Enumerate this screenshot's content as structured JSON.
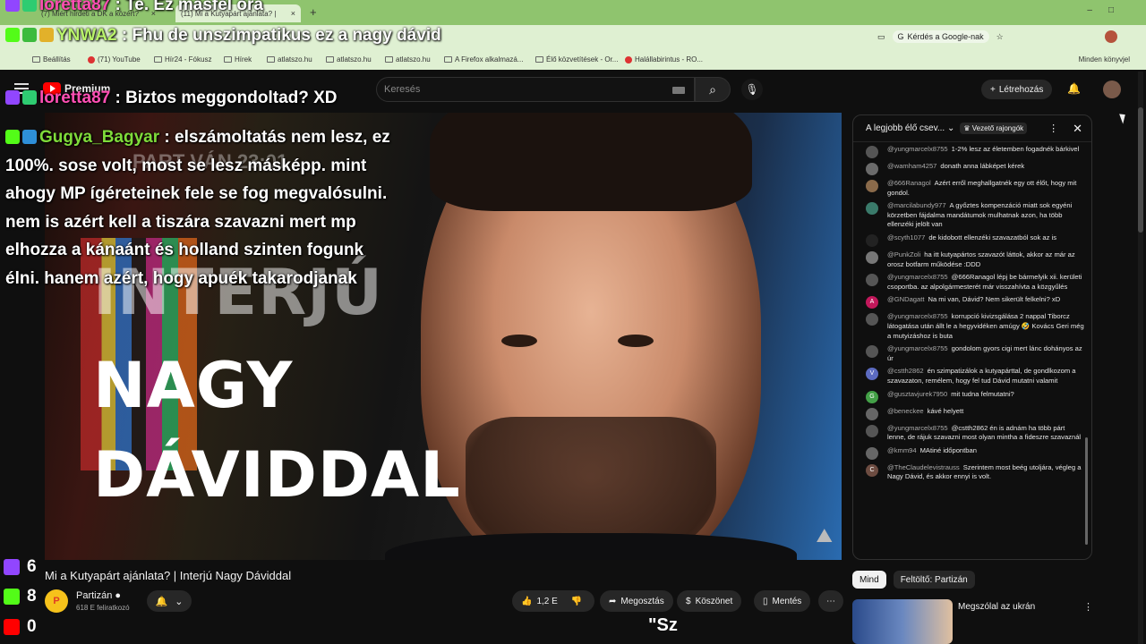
{
  "browser": {
    "tabs": [
      {
        "label": "(7) Miért hirdeti a DK a közért?"
      },
      {
        "label": "(11) Mi a Kutyapárt ajánlata? |"
      }
    ],
    "new_tab": "+",
    "google_search_label": "Kérdés a Google-nak",
    "bookmarks": [
      {
        "label": "Beállítás"
      },
      {
        "label": "(71) YouTube"
      },
      {
        "label": "Hír24 - Fókusz"
      },
      {
        "label": "Hírek"
      },
      {
        "label": "atlatszo.hu"
      },
      {
        "label": "atlatszo.hu"
      },
      {
        "label": "atlatszo.hu"
      },
      {
        "label": "A Firefox alkalmazá..."
      },
      {
        "label": "Élő közvetítések - Or..."
      },
      {
        "label": "Halállabirintus - RO..."
      }
    ],
    "bookmarks_right": "Minden könyvjel"
  },
  "youtube": {
    "logo_text": "Premium",
    "search_placeholder": "Keresés",
    "create_label": "Létrehozás"
  },
  "video": {
    "title_overlay_lines": [
      "INTERJÚ",
      "NAGY",
      "DÁVIDDAL"
    ],
    "part_text": "PART VÁN 23:01",
    "title": "Mi a Kutyapárt ajánlata? | Interjú Nagy Dáviddal",
    "channel_name": "Partizán",
    "channel_initial": "P",
    "subscribers": "618 E feliratkozó",
    "likes": "1,2 E",
    "share_label": "Megosztás",
    "thanks_label": "Köszönet",
    "save_label": "Mentés",
    "caption": "\"Sz"
  },
  "live_chat": {
    "header_title": "A legjobb élő csev...",
    "leader_label": "Vezető rajongók",
    "messages": [
      {
        "author": "@yungmarcelx8755",
        "text": "1-2% lesz az életemben fogadnék bárkivel",
        "avatar": ""
      },
      {
        "author": "@wamham4257",
        "text": "donath anna lábképet kérek",
        "avatar": ""
      },
      {
        "author": "@666Ranagol",
        "text": "Azért erről meghallgatnék egy ott élőt, hogy mit gondol.",
        "avatar": ""
      },
      {
        "author": "@marcilabundy977",
        "text": "A győztes kompenzáció miatt sok egyéni körzetben fájdalma mandátumok mulhatnak azon, ha több ellenzéki jelölt van",
        "avatar": ""
      },
      {
        "author": "@scyth1077",
        "text": "de kidobott ellenzéki szavazatból sok az is",
        "avatar": ""
      },
      {
        "author": "@PunkZoli",
        "text": "ha itt kutyapártos szavazót láttok, akkor az már az orosz botfarm működése :DDD",
        "avatar": ""
      },
      {
        "author": "@yungmarcelx8755",
        "text": "@666Ranagol lépj be bármelyik xii. kerületi csoportba. az alpolgármesterét már visszahívta a közgyűlés",
        "avatar": ""
      },
      {
        "author": "@GNDagatt",
        "text": "Na mi van, Dávid? Nem sikerült felkelni? xD",
        "avatar": "A"
      },
      {
        "author": "@yungmarcelx8755",
        "text": "korrupció kivizsgálása 2 nappal Tiborcz látogatása után állt le a hegyvidéken amúgy 🤣 Kovács Geri még a mutyizáshoz is buta",
        "avatar": ""
      },
      {
        "author": "@yungmarcelx8755",
        "text": "gondolom gyors cigi mert lánc dohányos az úr",
        "avatar": ""
      },
      {
        "author": "@cstth2862",
        "text": "én szimpatizálok a kutyapárttal, de gondlkozom a szavazaton, remélem, hogy fel tud Dávid mutatni valamit",
        "avatar": "V"
      },
      {
        "author": "@gusztavjurek7950",
        "text": "mit tudna felmutatni?",
        "avatar": "G"
      },
      {
        "author": "@beneckee",
        "text": "kávé helyett",
        "avatar": ""
      },
      {
        "author": "@yungmarcelx8755",
        "text": "@cstth2862 én is adnám ha több párt lenne, de rájuk szavazni most olyan mintha a fideszre szavaznál",
        "avatar": ""
      },
      {
        "author": "@kmm94",
        "text": "MAtiné időpontban",
        "avatar": ""
      },
      {
        "author": "@TheClaudelevistrauss",
        "text": "Szerintem most beég utoljára, végleg a Nagy Dávid, és akkor ennyi is volt.",
        "avatar": "C"
      }
    ]
  },
  "recommendations": {
    "chips": [
      {
        "label": "Mind"
      },
      {
        "label": "Feltöltő: Partizán"
      }
    ],
    "first_title": "Megszólal az ukrán"
  },
  "stream_overlay": {
    "messages": [
      {
        "user": "loretta87",
        "text": ": Te. Ez másfél óra"
      },
      {
        "user": "YNWA2",
        "text": ": Fhu de unszimpatikus ez a nagy dávid"
      },
      {
        "user": "loretta87",
        "text": ": Biztos meggondoltad? XD"
      },
      {
        "user": "Gugya_Bagyar",
        "text": ": elszámoltatás nem lesz, ez 100%. sose volt, most se lesz másképp. mint ahogy MP ígéreteinek fele se fog megvalósulni. nem is azért kell a tiszára szavazni mert mp elhozza a kánaánt és holland szinten fogunk élni. hanem azért, hogy apuék takarodjanak"
      }
    ],
    "viewer_counts": {
      "twitch": "6",
      "kick": "8",
      "youtube": "0"
    }
  },
  "colors": {
    "tab_bg": "#8fc46e",
    "yt_red": "#ff0000",
    "twitch": "#9146ff",
    "kick": "#53fc18"
  }
}
